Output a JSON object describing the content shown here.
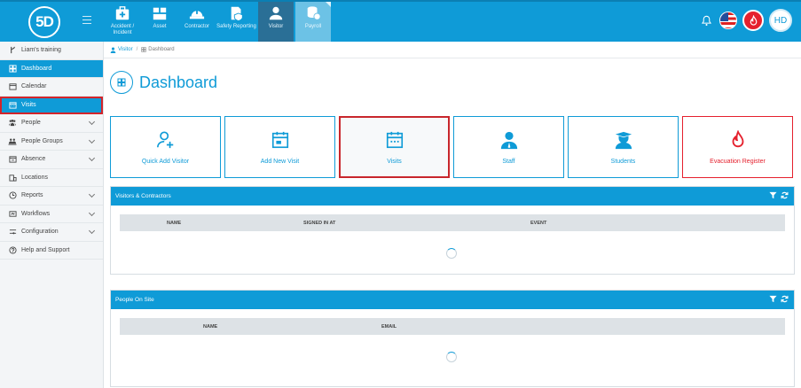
{
  "app": {
    "logo_text": "5D",
    "brand_color": "#0f9bd7",
    "alert_color": "#e5202d"
  },
  "topbar": {
    "modules": [
      {
        "label": "Accident / Incident",
        "icon": "first-aid-kit-icon"
      },
      {
        "label": "Asset",
        "icon": "boxes-icon"
      },
      {
        "label": "Contractor",
        "icon": "hard-hat-icon"
      },
      {
        "label": "Safety Reporting",
        "icon": "safety-report-icon"
      },
      {
        "label": "Visitor",
        "icon": "person-icon"
      },
      {
        "label": "Payroll",
        "icon": "coins-icon"
      }
    ],
    "active_module": "Visitor",
    "avatar_initials": "HD"
  },
  "sidebar": {
    "items": [
      {
        "label": "Liam's training",
        "icon": "branch-icon",
        "chevron": false
      },
      {
        "label": "Dashboard",
        "icon": "dashboard-icon",
        "chevron": false
      },
      {
        "label": "Calendar",
        "icon": "calendar-icon",
        "chevron": false
      },
      {
        "label": "Visits",
        "icon": "calendar-grid-icon",
        "chevron": false
      },
      {
        "label": "People",
        "icon": "people-icon",
        "chevron": true
      },
      {
        "label": "People Groups",
        "icon": "people-group-icon",
        "chevron": true
      },
      {
        "label": "Absence",
        "icon": "absence-icon",
        "chevron": true
      },
      {
        "label": "Locations",
        "icon": "building-icon",
        "chevron": false
      },
      {
        "label": "Reports",
        "icon": "clock-icon",
        "chevron": true
      },
      {
        "label": "Workflows",
        "icon": "workflow-icon",
        "chevron": true
      },
      {
        "label": "Configuration",
        "icon": "config-icon",
        "chevron": true
      },
      {
        "label": "Help and Support",
        "icon": "help-icon",
        "chevron": false
      }
    ]
  },
  "breadcrumb": {
    "root": "Visitor",
    "current": "Dashboard"
  },
  "page": {
    "title": "Dashboard"
  },
  "tiles": [
    {
      "label": "Quick Add Visitor",
      "icon": "add-user-icon"
    },
    {
      "label": "Add New Visit",
      "icon": "calendar-add-icon"
    },
    {
      "label": "Visits",
      "icon": "calendar-grid-icon"
    },
    {
      "label": "Staff",
      "icon": "staff-icon"
    },
    {
      "label": "Students",
      "icon": "student-icon"
    },
    {
      "label": "Evacuation Register",
      "icon": "fire-icon"
    }
  ],
  "panels": {
    "visitors": {
      "title": "Visitors & Contractors",
      "columns": [
        "NAME",
        "SIGNED IN AT",
        "EVENT"
      ]
    },
    "onsite": {
      "title": "People On Site",
      "columns": [
        "NAME",
        "EMAIL"
      ]
    }
  }
}
